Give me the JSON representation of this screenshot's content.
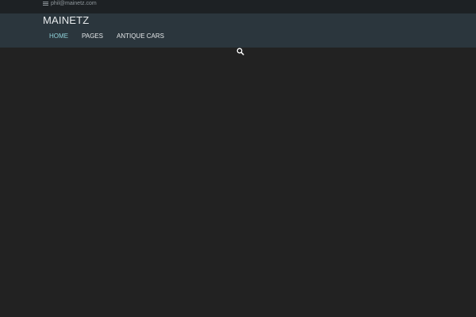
{
  "topbar": {
    "contact_icon": "envelope-icon",
    "email": "phil@mainetz.com"
  },
  "header": {
    "site_title": "MAINETZ",
    "nav": [
      {
        "label": "HOME",
        "active": true
      },
      {
        "label": "PAGES",
        "active": false
      },
      {
        "label": "ANTIQUE CARS",
        "active": false
      }
    ]
  },
  "search": {
    "icon": "search-icon"
  },
  "colors": {
    "topbar_bg": "#1d2124",
    "header_bg": "#2b363d",
    "page_bg": "#222222",
    "active_nav": "#8fd1d9",
    "nav_text": "#e4e7e9"
  }
}
